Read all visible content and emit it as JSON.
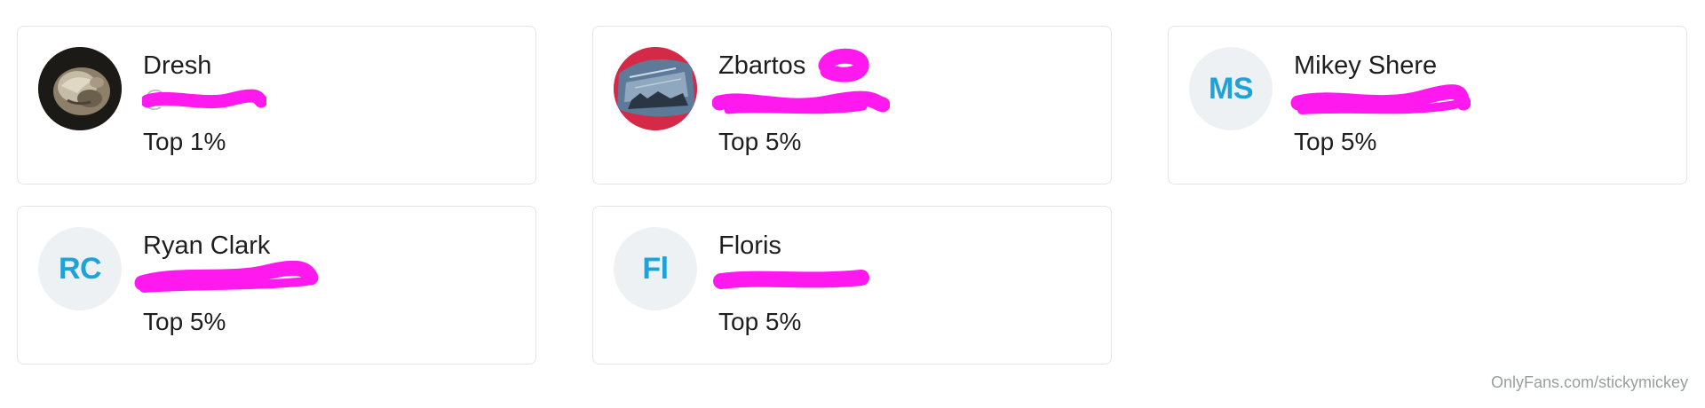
{
  "cards": [
    {
      "name": "Dresh",
      "initials": "",
      "avatar": "photo-cat",
      "handle": "@",
      "rank": "Top 1%"
    },
    {
      "name": "Zbartos",
      "initials": "",
      "avatar": "photo-car-window",
      "handle": "",
      "rank": "Top 5%"
    },
    {
      "name": "Mikey Shere",
      "initials": "MS",
      "avatar": "initials",
      "handle": "",
      "rank": "Top 5%"
    },
    {
      "name": "Ryan Clark",
      "initials": "RC",
      "avatar": "initials",
      "handle": "",
      "rank": "Top 5%"
    },
    {
      "name": "Floris",
      "initials": "Fl",
      "avatar": "initials",
      "handle": "",
      "rank": "Top 5%"
    }
  ],
  "watermark": "OnlyFans.com/stickymickey",
  "colors": {
    "initials_text": "#1fa2d8",
    "avatar_bg": "#eef1f3",
    "card_border": "#e2e4e6",
    "redaction": "#ff19ee"
  }
}
